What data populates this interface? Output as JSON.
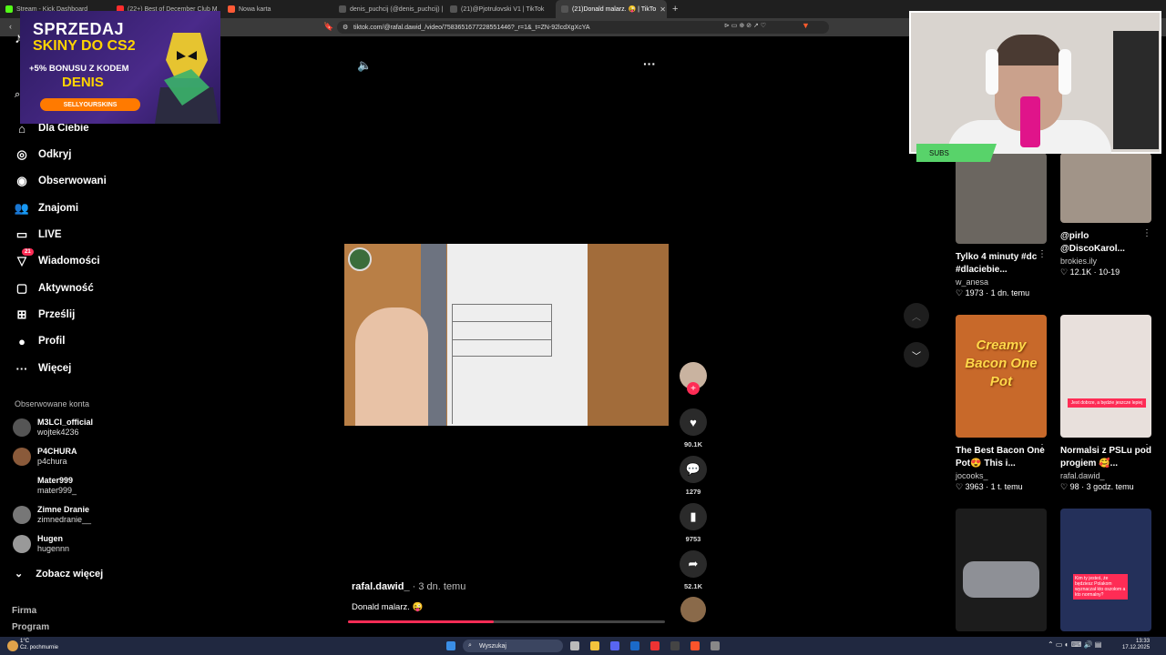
{
  "browser": {
    "tabs": [
      {
        "label": "Stream - Kick Dashboard",
        "fav": "#53fc18"
      },
      {
        "label": "(22+) Best of December Club M",
        "fav": "#ff2d2d"
      },
      {
        "label": "Nowa karta",
        "fav": "#ff5a36"
      },
      {
        "label": "denis_puchcij (@denis_puchcij) | TikT",
        "fav": "#555"
      },
      {
        "label": "(21)@Pjotrulovski V1 | TikTok",
        "fav": "#555"
      },
      {
        "label": "(21)Donald malarz. 😜 | TikTo",
        "fav": "#555",
        "active": true
      }
    ],
    "new_tab": "+",
    "url": "tiktok.com/@rafal.dawid_/video/7583651677228551446?_r=1&_t=ZN-92lcdXgXcYA"
  },
  "ad": {
    "line1": "SPRZEDAJ",
    "line2": "SKINY DO CS2",
    "line3": "+5% BONUSU Z KODEM",
    "line4": "DENIS",
    "brand": "SELLYOURSKINS"
  },
  "sidebar": {
    "items": [
      {
        "label": "Dla Ciebie",
        "icon": "home-icon",
        "glyph": "⌂"
      },
      {
        "label": "Odkryj",
        "icon": "compass-icon",
        "glyph": "◎"
      },
      {
        "label": "Obserwowani",
        "icon": "following-icon",
        "glyph": "◉"
      },
      {
        "label": "Znajomi",
        "icon": "friends-icon",
        "glyph": "👥"
      },
      {
        "label": "LIVE",
        "icon": "live-icon",
        "glyph": "▭"
      },
      {
        "label": "Wiadomości",
        "icon": "messages-icon",
        "glyph": "▽",
        "badge": "21"
      },
      {
        "label": "Aktywność",
        "icon": "activity-icon",
        "glyph": "▢"
      },
      {
        "label": "Prześlij",
        "icon": "upload-icon",
        "glyph": "⊞"
      },
      {
        "label": "Profil",
        "icon": "profile-icon",
        "glyph": "●"
      },
      {
        "label": "Więcej",
        "icon": "more-icon",
        "glyph": "···"
      }
    ],
    "section_title": "Obserwowane konta",
    "accounts": [
      {
        "name": "M3LCI_official",
        "handle": "wojtek4236",
        "color": "#555"
      },
      {
        "name": "P4CHURA",
        "handle": "p4chura",
        "color": "#8a5a3a"
      },
      {
        "name": "Mater999",
        "handle": "mater999_",
        "color": "#000"
      },
      {
        "name": "Zimne Dranie",
        "handle": "zimnedranie__",
        "color": "#777"
      },
      {
        "name": "Hugen",
        "handle": "hugennn",
        "color": "#999"
      }
    ],
    "see_more": "Zobacz więcej",
    "footer": [
      "Firma",
      "Program"
    ]
  },
  "video": {
    "author": "rafal.dawid_",
    "time": "· 3 dn. temu",
    "caption": "Donald malarz. 😜",
    "progress": 0.46,
    "likes": "90.1K",
    "comments": "1279",
    "saves": "9753",
    "shares": "52.1K"
  },
  "webcam": {
    "label": "SUBS"
  },
  "recommended": [
    {
      "title": "Tylko 4 minuty #dc #dlaciebie...",
      "user": "w_anesa",
      "likes": "1973",
      "time": "1 dn. temu",
      "bg": "#6b6660"
    },
    {
      "title": "@pirlo @DiscoKarol...",
      "user": "brokies.ily",
      "likes": "12.1K",
      "time": "10-19",
      "bg": "#a19488"
    },
    {
      "title": "The Best Bacon One Pot😍 This i...",
      "user": "jocooks_",
      "likes": "3963",
      "time": "1 t. temu",
      "bg": "#c8692a",
      "overlay": "Creamy Bacon One Pot"
    },
    {
      "title": "Normalsi z PSLu pod progiem 🥰...",
      "user": "rafal.dawid_",
      "likes": "98",
      "time": "3 godz. temu",
      "bg": "#e8e0dc",
      "overlay": "Jest dobrze, a będzie jeszcze lepiej"
    },
    {
      "title": "",
      "user": "",
      "likes": "",
      "time": "",
      "bg": "#1c1c1c"
    },
    {
      "title": "",
      "user": "",
      "likes": "",
      "time": "",
      "bg": "#24305a",
      "overlay": "Kim ty jesteś, że będziesz Polakom wyznaczał kto oszołom a kto normalny?"
    }
  ],
  "taskbar": {
    "search": "Wyszukaj",
    "temp": "1°C",
    "weather": "Cz. pochmurnie",
    "time": "13:33",
    "date": "17.12.2025"
  }
}
